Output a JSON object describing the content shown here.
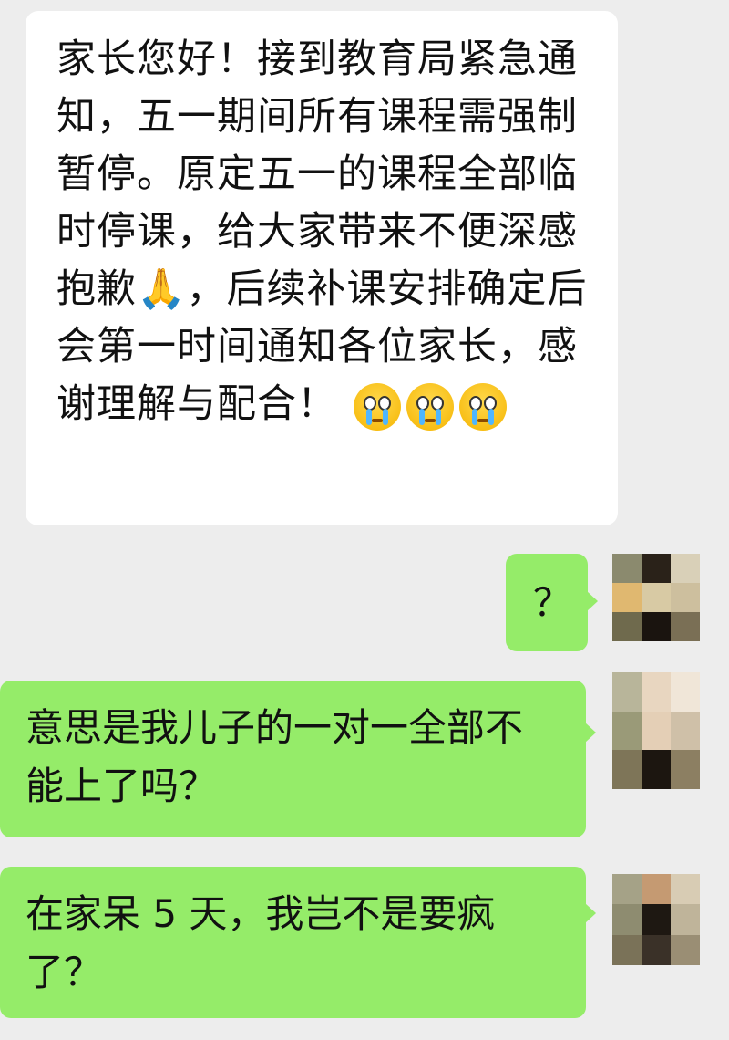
{
  "messages": [
    {
      "side": "incoming",
      "text": "家长您好！接到教育局紧急通知，五一期间所有课程需强制暂停。原定五一的课程全部临时停课，给大家带来不便深感抱歉🙏，后续补课安排确定后会第一时间通知各位家长，感谢理解与配合！",
      "emojis": [
        "crying-face",
        "crying-face",
        "crying-face"
      ]
    },
    {
      "side": "outgoing",
      "text": "？",
      "avatar": "pixelated-avatar"
    },
    {
      "side": "outgoing",
      "text": "意思是我儿子的一对一全部不能上了吗？",
      "avatar": "pixelated-avatar"
    },
    {
      "side": "outgoing",
      "text": "在家呆 5 天，我岂不是要疯了？",
      "avatar": "pixelated-avatar"
    }
  ],
  "colors": {
    "background": "#ededed",
    "incoming_bubble": "#ffffff",
    "outgoing_bubble": "#95ec69"
  }
}
